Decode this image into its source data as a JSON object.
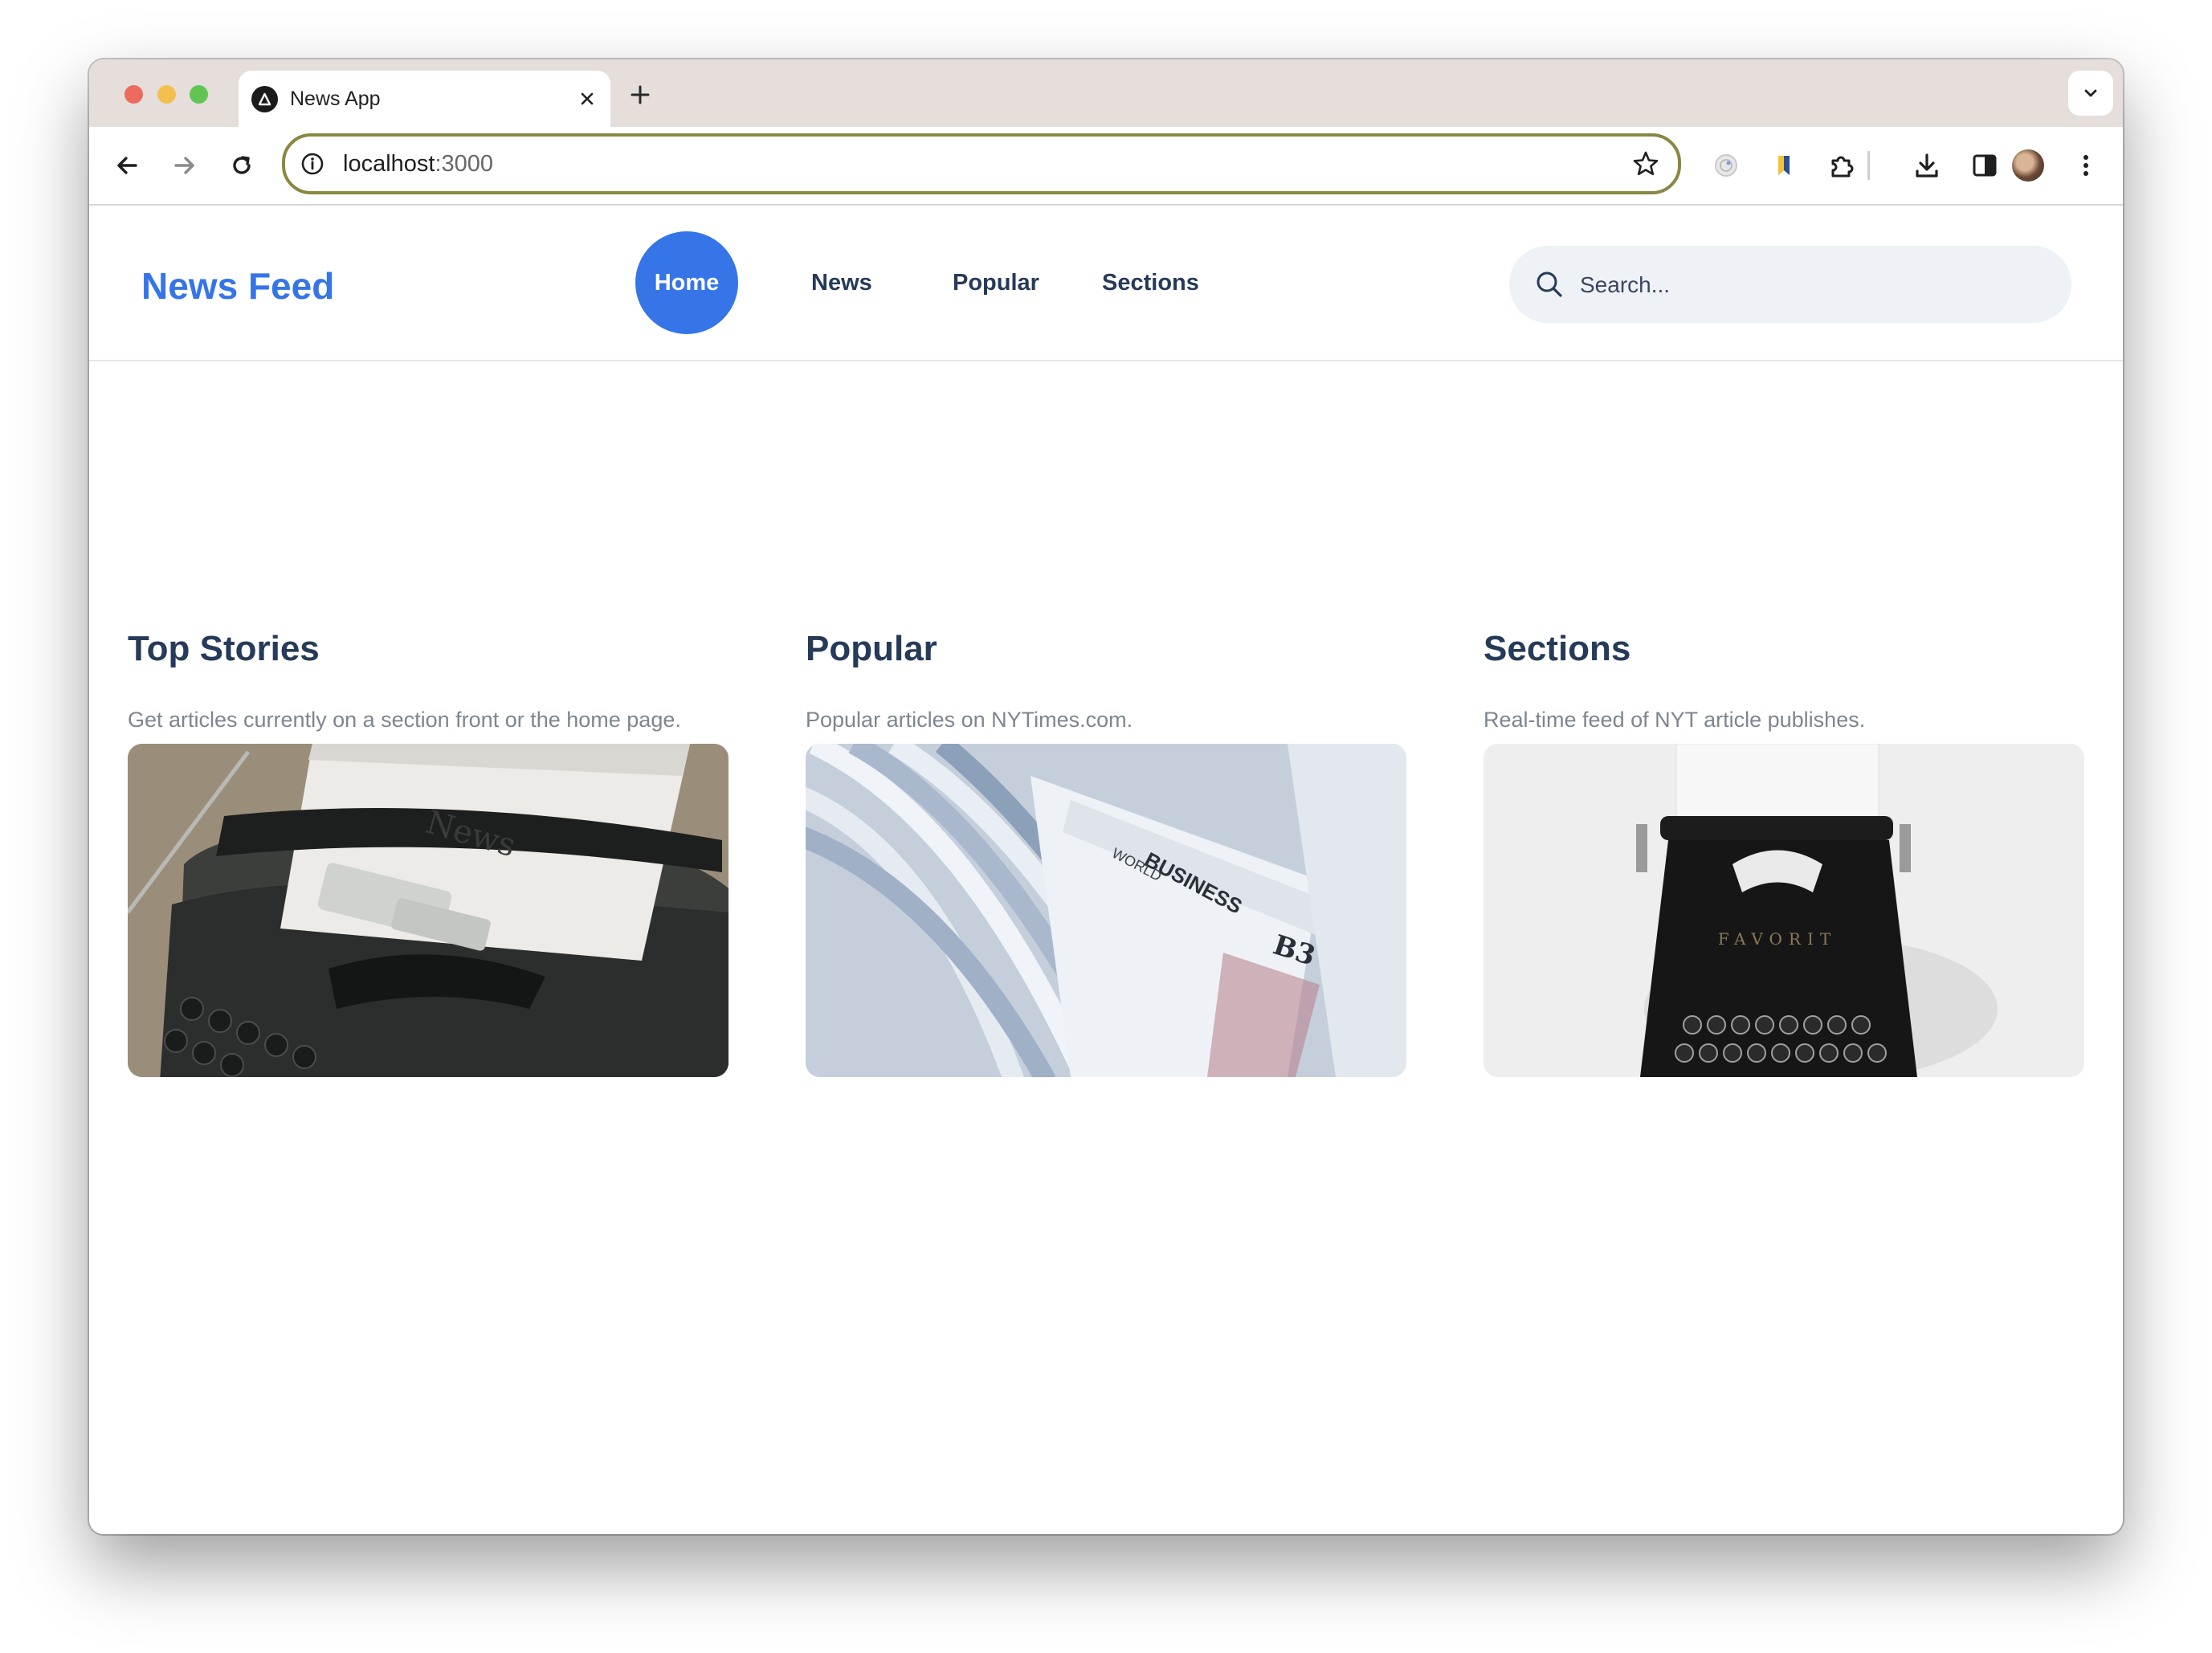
{
  "browser": {
    "tab_title": "News App",
    "url_host": "localhost",
    "url_port": ":3000",
    "traffic_lights": [
      "#ed6a5e",
      "#f5bf4f",
      "#61c554"
    ]
  },
  "nav": {
    "logo": "News Feed",
    "links": [
      "Home",
      "News",
      "Popular",
      "Sections"
    ],
    "active": "Home",
    "accent_color": "#3575e8",
    "search_placeholder": "Search..."
  },
  "cards": [
    {
      "title": "Top Stories",
      "description": "Get articles currently on a section front or the home page.",
      "image": "typewriter-news-photo",
      "image_text": "News"
    },
    {
      "title": "Popular",
      "description": "Popular articles on NYTimes.com.",
      "image": "newspapers-stack-photo",
      "image_text": [
        "BUSINESS",
        "B3",
        "WORLD"
      ]
    },
    {
      "title": "Sections",
      "description": "Real-time feed of NYT article publishes.",
      "image": "black-typewriter-photo",
      "image_text": "FAVORIT"
    }
  ]
}
